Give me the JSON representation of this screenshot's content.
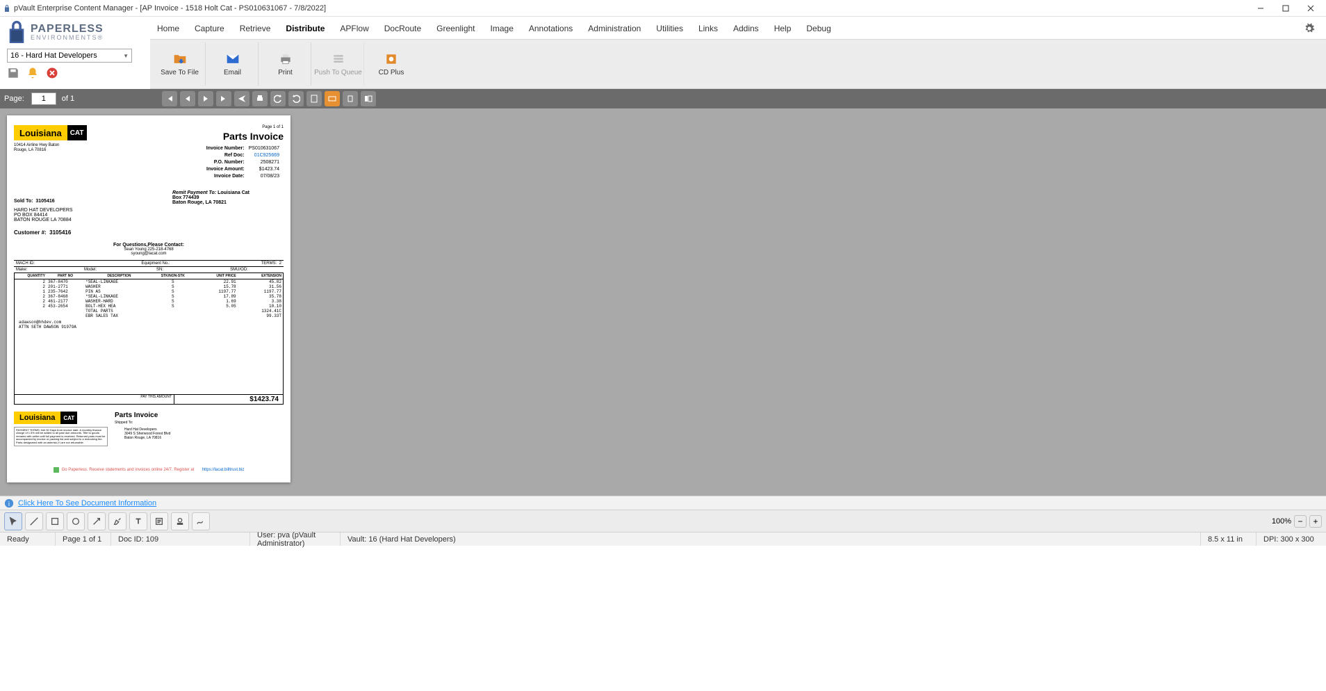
{
  "window": {
    "title": "pVault Enterprise Content Manager - [AP Invoice - 1518 Holt Cat - PS010631067 - 7/8/2022]"
  },
  "brand": {
    "line1": "PAPERLESS",
    "line2": "ENVIRONMENTS®"
  },
  "menu": {
    "items": [
      "Home",
      "Capture",
      "Retrieve",
      "Distribute",
      "APFlow",
      "DocRoute",
      "Greenlight",
      "Image",
      "Annotations",
      "Administration",
      "Utilities",
      "Links",
      "Addins",
      "Help",
      "Debug"
    ],
    "active_index": 3
  },
  "ribbon": {
    "items": [
      {
        "label": "Save To File",
        "disabled": false,
        "icon": "folder"
      },
      {
        "label": "Email",
        "disabled": false,
        "icon": "mail"
      },
      {
        "label": "Print",
        "disabled": false,
        "icon": "printer"
      },
      {
        "label": "Push To Queue",
        "disabled": true,
        "icon": "queue"
      },
      {
        "label": "CD Plus",
        "disabled": false,
        "icon": "cd"
      }
    ]
  },
  "left": {
    "combo_value": "16 - Hard Hat Developers"
  },
  "pagebar": {
    "label": "Page:",
    "current": "1",
    "of": "of 1"
  },
  "invoice": {
    "page_of": "Page 1 of 1",
    "title": "Parts Invoice",
    "vendor_logo_left": "Louisiana",
    "vendor_logo_right": "CAT",
    "vendor_addr1": "10414 Airline Hwy Baton",
    "vendor_addr2": "Rouge, LA 70816",
    "meta": [
      {
        "k": "Invoice Number:",
        "v": "PS010631067"
      },
      {
        "k": "Ref Doc:",
        "v": "01C925669",
        "link": true
      },
      {
        "k": "P.O. Number:",
        "v": "2508271"
      },
      {
        "k": "Invoice Amount:",
        "v": "$1423.74"
      },
      {
        "k": "Invoice Date:",
        "v": "07/08/23"
      }
    ],
    "soldto_label": "Sold To:",
    "soldto_id": "3105416",
    "soldto_lines": [
      "HARD HAT DEVELOPERS",
      "PO BOX 84414",
      "BATON ROUGE LA 70884"
    ],
    "remit_label": "Remit Payment To:",
    "remit_lines": [
      "Louisiana Cat",
      "Box 774439",
      "Baton Rouge, LA 70821"
    ],
    "customer_label": "Customer #:",
    "customer_no": "3105416",
    "questions": "For Questions,Please Contact:",
    "questions_sub1": "Sean Young 225-218-4768",
    "questions_sub2": "syoung@lacat.com",
    "hdr1": {
      "mach": "MACH ID:",
      "eq": "Equipment No.:",
      "terms": "TERMS:",
      "terms_v": "2"
    },
    "hdr2": {
      "make": "Make:",
      "model": "Model:",
      "sn": "SN:",
      "smu": "SMU/OD:"
    },
    "cols": [
      "QUANTITY",
      "PART NO",
      "DESCRIPTION",
      "STK/NON-STK",
      "UNIT PRICE",
      "EXTENSION"
    ],
    "items": [
      {
        "q": "2",
        "pn": "367-8470",
        "d": "*SEAL-LINKAGE",
        "s": "S",
        "up": "22.91",
        "ex": "45.82"
      },
      {
        "q": "2",
        "pn": "201-2771",
        "d": "WASHER",
        "s": "S",
        "up": "15.78",
        "ex": "31.56"
      },
      {
        "q": "1",
        "pn": "235-7642",
        "d": "PIN AS",
        "s": "S",
        "up": "1197.77",
        "ex": "1197.77"
      },
      {
        "q": "2",
        "pn": "367-8468",
        "d": "*SEAL-LINKAGE",
        "s": "S",
        "up": "17.89",
        "ex": "35.78"
      },
      {
        "q": "2",
        "pn": "461-2177",
        "d": "WASHER-HARD",
        "s": "S",
        "up": "1.69",
        "ex": "3.38"
      },
      {
        "q": "2",
        "pn": "453-2654",
        "d": "BOLT-HEX HEA",
        "s": "S",
        "up": "5.05",
        "ex": "10.10"
      }
    ],
    "totals": [
      {
        "d": "TOTAL PARTS",
        "ex": "1324.41C"
      },
      {
        "d": "EBR SALES TAX",
        "ex": "99.33T"
      }
    ],
    "email_line": "adawson@hhdev.com",
    "attn_line": "ATTN SETH DAWSON 91979A",
    "paythis_label": "PAY THIS AMOUNT",
    "paythis_value": "$1423.74",
    "stub_title": "Parts Invoice",
    "stub_ship_label": "Shipped To:",
    "stub_ship": [
      "Hard Hat Developers",
      "3049 S Sherwood Forest Blvd",
      "Baton Rouge, LA 70816"
    ],
    "stub_terms": "PAYMENT TERMS: Net 30 Days from invoice date. A monthly finance charge of 1.5% will be added to all past due amounts. Title to goods remains with seller until full payment is received. Returned parts must be accompanied by invoice or packing list and subject to a restocking fee. Parts designated with an asterisk (*) are not returnable.",
    "gopaper_left": "Go Paperless.  Receive statements and invoices online 24/7. Register at",
    "gopaper_link": "https://lacat.billtrust.biz"
  },
  "info_link": "Click Here To See Document Information",
  "zoom": {
    "label": "100%"
  },
  "status": {
    "ready": "Ready",
    "page": "Page 1 of 1",
    "docid": "Doc ID: 109",
    "user": "User: pva (pVault Administrator)",
    "vault": "Vault: 16 (Hard Hat Developers)",
    "size": "8.5 x 11 in",
    "dpi": "DPI: 300 x 300"
  }
}
